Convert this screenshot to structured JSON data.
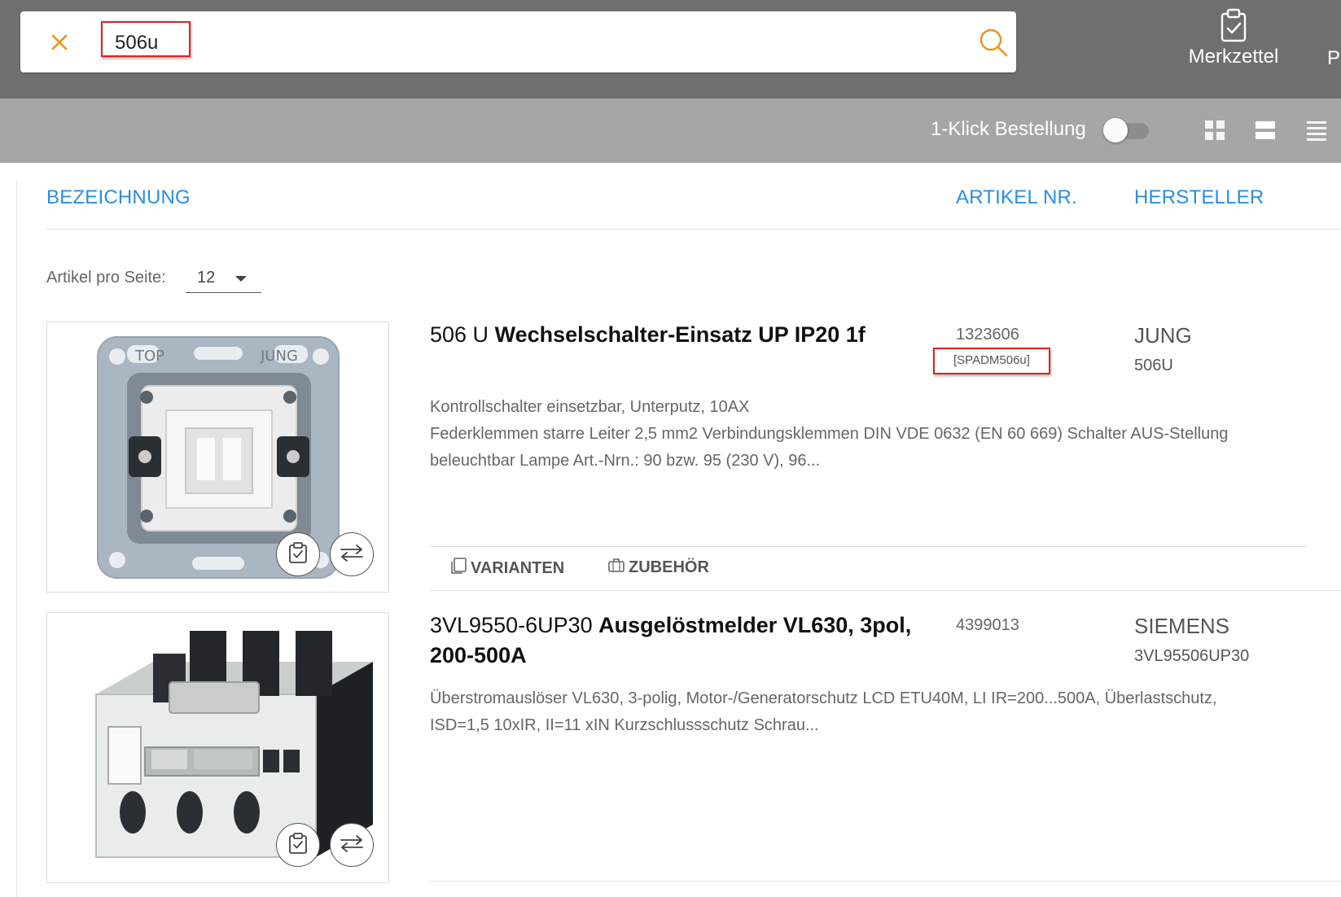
{
  "header": {
    "search_value": "506u",
    "merkzettel_label": "Merkzettel",
    "more_label": "P"
  },
  "toolbar": {
    "oneclick_label": "1-Klick Bestellung",
    "oneclick_enabled": false
  },
  "columns": {
    "designation": "BEZEICHNUNG",
    "article_nr": "ARTIKEL NR.",
    "manufacturer": "HERSTELLER"
  },
  "pagination": {
    "per_page_label": "Artikel pro Seite:",
    "per_page_value": "12"
  },
  "products": [
    {
      "code": "506 U",
      "name": "Wechselschalter-Einsatz UP IP20 1f",
      "article_nr": "1323606",
      "alt_code": "[SPADM506u]",
      "brand": "JUNG",
      "brand_code": "506U",
      "desc_line1": "Kontrollschalter einsetzbar, Unterputz, 10AX",
      "desc_line2": "Federklemmen starre Leiter 2,5 mm2 Verbindungsklemmen DIN VDE 0632 (EN 60 669) Schalter AUS-Stellung",
      "desc_line3": "beleuchtbar Lampe Art.-Nrn.: 90 bzw. 95 (230 V), 96...",
      "tab_variants": "VARIANTEN",
      "tab_accessories": "ZUBEHÖR",
      "image_text_top": "TOP",
      "image_text_brand": "JUNG"
    },
    {
      "code": "3VL9550-6UP30",
      "name": "Ausgelöstmelder VL630, 3pol, 200-500A",
      "article_nr": "4399013",
      "brand": "SIEMENS",
      "brand_code": "3VL95506UP30",
      "desc_line1": "Überstromauslöser VL630, 3-polig, Motor-/Generatorschutz LCD ETU40M, LI IR=200...500A, Überlastschutz,",
      "desc_line2": "ISD=1,5 10xIR, II=11 xIN Kurzschlussschutz Schrau..."
    }
  ]
}
